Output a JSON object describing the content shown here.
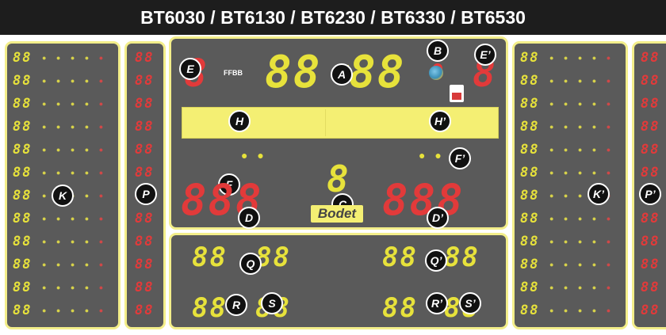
{
  "title": "BT6030 / BT6130 / BT6230 / BT6330 / BT6530",
  "colors": {
    "panel": "#5a5a5a",
    "border": "#f3ee8a",
    "led_yellow": "#e7e23b",
    "led_red": "#e23a3a",
    "banner": "#1d1d1d"
  },
  "labels": {
    "A": "A",
    "B": "B",
    "C": "C",
    "D": "D",
    "D2": "D’",
    "E": "E",
    "E2": "E’",
    "F": "F",
    "F2": "F’",
    "H": "H",
    "H2": "H’",
    "K": "K",
    "K2": "K’",
    "P": "P",
    "P2": "P’",
    "Q": "Q",
    "Q2": "Q’",
    "R": "R",
    "R2": "R’",
    "S": "S",
    "S2": "S’"
  },
  "digits": {
    "pair": "88",
    "single": "8",
    "triple": "888",
    "clock_left": "88",
    "clock_right": "88",
    "clock_sep": ":"
  },
  "fouls_dots": "● ● ● ● ●",
  "team_fouls_dots": "● ●",
  "logos": {
    "ffbb": "FFBB",
    "brand": "Bodet"
  }
}
